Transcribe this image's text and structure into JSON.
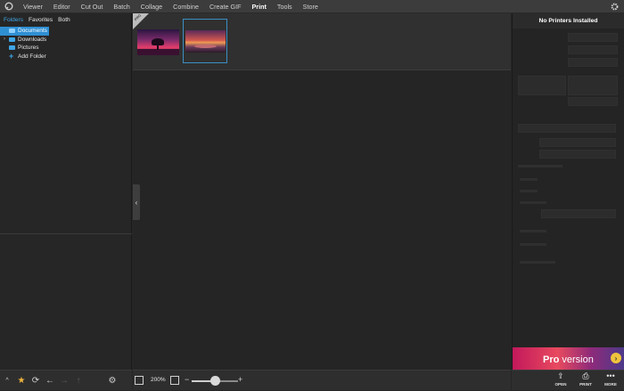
{
  "menu": {
    "items": [
      "Viewer",
      "Editor",
      "Cut Out",
      "Batch",
      "Collage",
      "Combine",
      "Create GIF",
      "Print",
      "Tools",
      "Store"
    ],
    "active": "Print"
  },
  "browser": {
    "tabs": [
      "Folders",
      "Favorites",
      "Both"
    ],
    "active_tab": "Folders",
    "folders": [
      {
        "label": "Documents",
        "selected": true,
        "expandable": false
      },
      {
        "label": "Downloads",
        "selected": false,
        "expandable": true
      },
      {
        "label": "Pictures",
        "selected": false,
        "expandable": false
      }
    ],
    "add_folder": "Add Folder"
  },
  "thumbnails": {
    "corner_badge": "PRO"
  },
  "print_panel": {
    "title": "No Printers Installed"
  },
  "ad": {
    "text_pro": "Pro",
    "text_version": " version"
  },
  "zoom": {
    "level": "200%",
    "slider_fraction": 0.5
  },
  "bottom_buttons": {
    "open": "OPEN",
    "print": "PRINT",
    "more": "MORE"
  },
  "colors": {
    "accent": "#3fa6e6",
    "selection": "#2f8fd3"
  }
}
